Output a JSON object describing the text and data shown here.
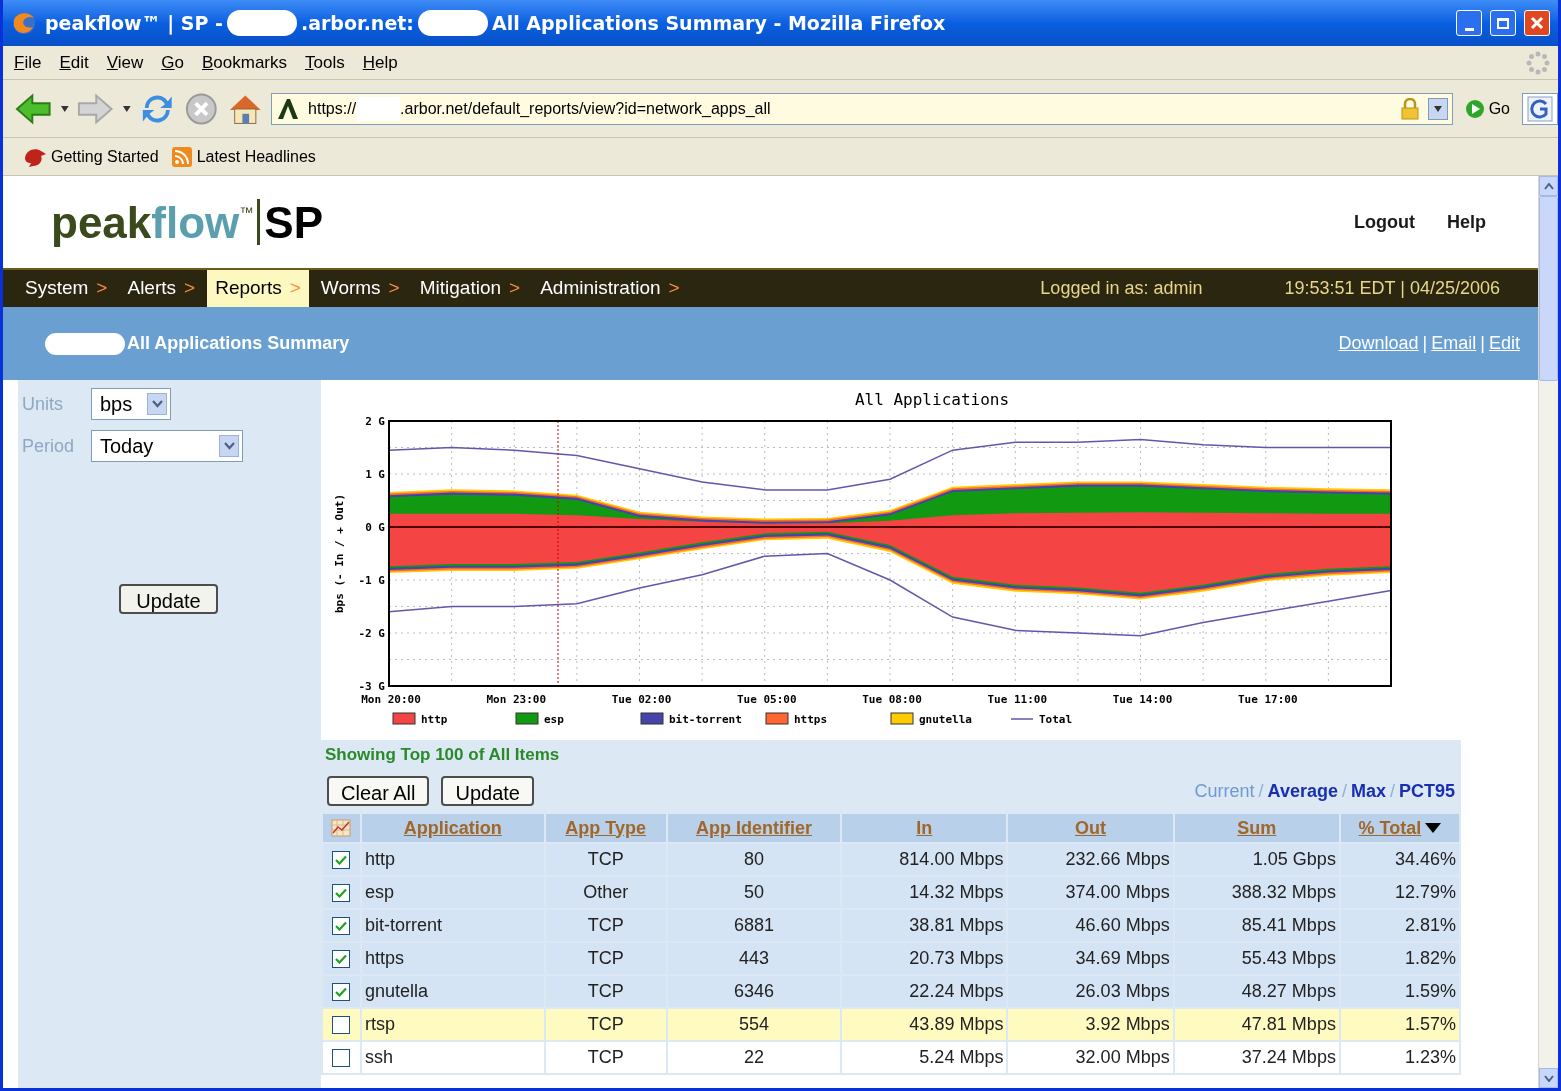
{
  "window": {
    "title_parts": [
      {
        "kind": "text",
        "text": "peakflow™ | SP -"
      },
      {
        "kind": "redacted"
      },
      {
        "kind": "text",
        "text": ".arbor.net:"
      },
      {
        "kind": "redacted"
      },
      {
        "kind": "text",
        "text": "All Applications Summary - Mozilla Firefox"
      }
    ]
  },
  "menu": [
    "File",
    "Edit",
    "View",
    "Go",
    "Bookmarks",
    "Tools",
    "Help"
  ],
  "address": {
    "parts": [
      {
        "kind": "text",
        "text": "https://"
      },
      {
        "kind": "redacted"
      },
      {
        "kind": "text",
        "text": ".arbor.net/default_reports/view?id=network_apps_all"
      }
    ],
    "go_label": "Go"
  },
  "bookmarks": [
    {
      "kind": "bird",
      "label": "Getting Started"
    },
    {
      "kind": "feed",
      "label": "Latest Headlines"
    }
  ],
  "logo": {
    "parts": [
      {
        "text": "peak",
        "color": "#3b4a1c"
      },
      {
        "text": "flow",
        "color": "#5b9fae"
      }
    ],
    "mark": "™",
    "product": "SP"
  },
  "header_links": [
    "Logout",
    "Help"
  ],
  "nav": [
    {
      "label": "System",
      "arrow": ">",
      "selected": false
    },
    {
      "label": "Alerts",
      "arrow": ">",
      "selected": false
    },
    {
      "label": "Reports",
      "arrow": ">",
      "selected": true
    },
    {
      "label": "Worms",
      "arrow": ">",
      "selected": false
    },
    {
      "label": "Mitigation",
      "arrow": ">",
      "selected": false
    },
    {
      "label": "Administration",
      "arrow": ">",
      "selected": false
    }
  ],
  "login": "Logged in as: admin",
  "datetime": "19:53:51 EDT | 04/25/2006",
  "page_title": {
    "redacted": true,
    "text": "All Applications Summary"
  },
  "page_links": [
    {
      "label": "Download"
    },
    {
      "label": "Email",
      "separator": "|"
    },
    {
      "label": "Edit",
      "separator": "|"
    }
  ],
  "filters": [
    {
      "label": "Units",
      "value": "bps",
      "kind": "short"
    },
    {
      "label": "Period",
      "value": "Today",
      "kind": "long"
    }
  ],
  "update_button": "Update",
  "chart": {
    "chart_data": {
      "type": "area",
      "title": "All Applications",
      "ylabel": "bps (- In / + Out)",
      "stacked": false,
      "grid": true,
      "legend": true,
      "ylim": [
        -3,
        2
      ],
      "categories": [
        "Mon 20:00",
        null,
        "Mon 23:00",
        null,
        "Tue 02:00",
        null,
        "Tue 05:00",
        null,
        "Tue 08:00",
        null,
        "Tue 11:00",
        null,
        "Tue 14:00",
        null,
        "Tue 17:00",
        null,
        null
      ],
      "yticks": [
        {
          "value": 2,
          "label": "2 G"
        },
        {
          "value": 1,
          "label": "1 G"
        },
        {
          "value": 0,
          "label": "0 G"
        },
        {
          "value": -1,
          "label": "-1 G"
        },
        {
          "value": -2,
          "label": "-2 G"
        },
        {
          "value": -3,
          "label": "-3 G"
        }
      ],
      "series": [
        {
          "name": "http",
          "type": "area",
          "color": "#f44444",
          "values": [
            0.25,
            0.25,
            0.25,
            0.22,
            0.15,
            0.1,
            0.06,
            0.07,
            0.12,
            0.22,
            0.26,
            0.27,
            0.28,
            0.27,
            0.26,
            0.25,
            0.25
          ]
        },
        {
          "name": "esp",
          "type": "area",
          "color": "#119911",
          "values": [
            0.56,
            0.61,
            0.59,
            0.51,
            0.19,
            0.1,
            0.06,
            0.07,
            0.22,
            0.66,
            0.71,
            0.76,
            0.76,
            0.71,
            0.66,
            0.63,
            0.61
          ]
        },
        {
          "name": "bit-torrent",
          "type": "area",
          "color": "#4444aa",
          "values": [
            0.6,
            0.65,
            0.63,
            0.55,
            0.23,
            0.14,
            0.1,
            0.11,
            0.26,
            0.7,
            0.75,
            0.8,
            0.8,
            0.75,
            0.7,
            0.67,
            0.65
          ]
        },
        {
          "name": "https",
          "type": "area",
          "color": "#ff6633",
          "values": [
            0.63,
            0.68,
            0.66,
            0.58,
            0.26,
            0.17,
            0.13,
            0.14,
            0.29,
            0.73,
            0.78,
            0.83,
            0.83,
            0.78,
            0.73,
            0.7,
            0.68
          ]
        },
        {
          "name": "gnutella",
          "type": "area",
          "color": "#ffcc00",
          "values": [
            0.66,
            0.71,
            0.69,
            0.61,
            0.29,
            0.2,
            0.16,
            0.17,
            0.32,
            0.76,
            0.81,
            0.86,
            0.86,
            0.81,
            0.76,
            0.73,
            0.71
          ]
        },
        {
          "name": "Total",
          "type": "line",
          "color": "#6655aa",
          "values": [
            1.45,
            1.5,
            1.45,
            1.35,
            1.1,
            0.85,
            0.7,
            0.7,
            0.9,
            1.45,
            1.6,
            1.6,
            1.65,
            1.55,
            1.5,
            1.5,
            1.5
          ]
        },
        {
          "type": "area",
          "color": "#f44444",
          "values": [
            -0.74,
            -0.7,
            -0.7,
            -0.66,
            -0.48,
            -0.29,
            -0.12,
            -0.09,
            -0.34,
            -0.94,
            -1.09,
            -1.14,
            -1.24,
            -1.09,
            -0.89,
            -0.79,
            -0.74
          ]
        },
        {
          "type": "area",
          "color": "#119911",
          "values": [
            -0.77,
            -0.73,
            -0.73,
            -0.69,
            -0.51,
            -0.32,
            -0.15,
            -0.12,
            -0.37,
            -0.97,
            -1.12,
            -1.17,
            -1.27,
            -1.12,
            -0.92,
            -0.82,
            -0.77
          ]
        },
        {
          "type": "area",
          "color": "#4444aa",
          "values": [
            -0.81,
            -0.77,
            -0.77,
            -0.73,
            -0.55,
            -0.36,
            -0.19,
            -0.16,
            -0.41,
            -1.01,
            -1.16,
            -1.21,
            -1.31,
            -1.16,
            -0.96,
            -0.86,
            -0.81
          ]
        },
        {
          "type": "area",
          "color": "#ff6633",
          "values": [
            -0.84,
            -0.8,
            -0.8,
            -0.76,
            -0.58,
            -0.39,
            -0.22,
            -0.19,
            -0.44,
            -1.04,
            -1.19,
            -1.24,
            -1.34,
            -1.19,
            -0.99,
            -0.89,
            -0.84
          ]
        },
        {
          "type": "area",
          "color": "#ffcc00",
          "values": [
            -0.87,
            -0.83,
            -0.83,
            -0.79,
            -0.61,
            -0.42,
            -0.25,
            -0.22,
            -0.47,
            -1.07,
            -1.22,
            -1.27,
            -1.37,
            -1.22,
            -1.02,
            -0.92,
            -0.87
          ]
        },
        {
          "type": "line",
          "color": "#6655aa",
          "values": [
            -1.6,
            -1.5,
            -1.5,
            -1.45,
            -1.15,
            -0.9,
            -0.55,
            -0.5,
            -1.0,
            -1.7,
            -1.95,
            -2.0,
            -2.05,
            -1.8,
            -1.6,
            -1.4,
            -1.2
          ]
        }
      ]
    }
  },
  "table": {
    "caption": "Showing Top 100 of All Items",
    "buttons": [
      "Clear All",
      "Update"
    ],
    "metrics": [
      {
        "label": "Current",
        "selected": true
      },
      {
        "label": "Average",
        "separator": "/",
        "selected": false
      },
      {
        "label": "Max",
        "separator": "/",
        "selected": false
      },
      {
        "label": "PCT95",
        "separator": "/",
        "selected": false
      }
    ],
    "columns": [
      {
        "kind": "icon"
      },
      {
        "kind": "text",
        "label": "Application"
      },
      {
        "kind": "text",
        "label": "App Type"
      },
      {
        "kind": "text",
        "label": "App Identifier"
      },
      {
        "kind": "text",
        "label": "In"
      },
      {
        "kind": "text",
        "label": "Out"
      },
      {
        "kind": "text",
        "label": "Sum"
      },
      {
        "kind": "text",
        "label": "% Total",
        "sorted": true
      }
    ],
    "rows": [
      {
        "checked": true,
        "highlighted": false,
        "cells": [
          "",
          "http",
          "TCP",
          "80",
          "814.00 Mbps",
          "232.66 Mbps",
          "1.05 Gbps",
          "34.46%"
        ]
      },
      {
        "checked": true,
        "highlighted": false,
        "cells": [
          "",
          "esp",
          "Other",
          "50",
          "14.32 Mbps",
          "374.00 Mbps",
          "388.32 Mbps",
          "12.79%"
        ]
      },
      {
        "checked": true,
        "highlighted": false,
        "cells": [
          "",
          "bit-torrent",
          "TCP",
          "6881",
          "38.81 Mbps",
          "46.60 Mbps",
          "85.41 Mbps",
          "2.81%"
        ]
      },
      {
        "checked": true,
        "highlighted": false,
        "cells": [
          "",
          "https",
          "TCP",
          "443",
          "20.73 Mbps",
          "34.69 Mbps",
          "55.43 Mbps",
          "1.82%"
        ]
      },
      {
        "checked": true,
        "highlighted": false,
        "cells": [
          "",
          "gnutella",
          "TCP",
          "6346",
          "22.24 Mbps",
          "26.03 Mbps",
          "48.27 Mbps",
          "1.59%"
        ]
      },
      {
        "checked": false,
        "highlighted": true,
        "cells": [
          "",
          "rtsp",
          "TCP",
          "554",
          "43.89 Mbps",
          "3.92 Mbps",
          "47.81 Mbps",
          "1.57%"
        ]
      },
      {
        "checked": false,
        "highlighted": false,
        "cells": [
          "",
          "ssh",
          "TCP",
          "22",
          "5.24 Mbps",
          "32.00 Mbps",
          "37.24 Mbps",
          "1.23%"
        ]
      }
    ]
  }
}
